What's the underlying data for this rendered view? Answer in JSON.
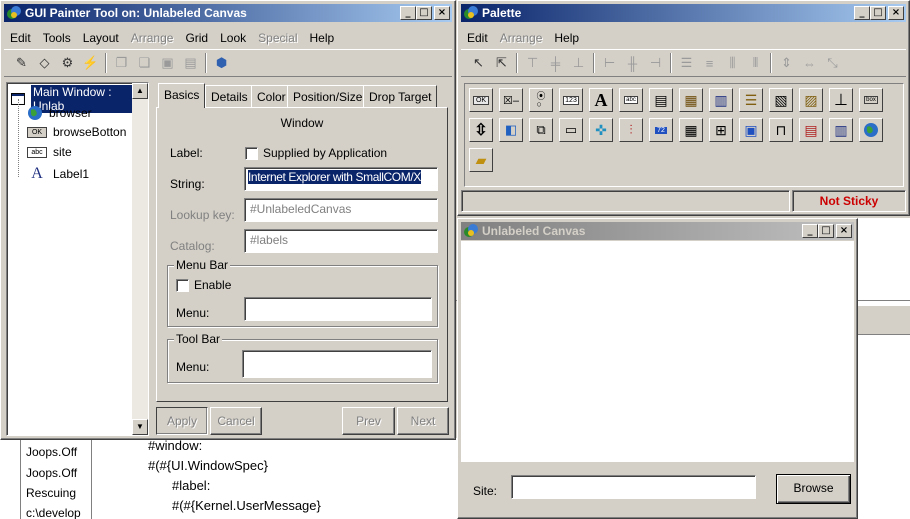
{
  "gp": {
    "title": "GUI Painter Tool on: Unlabeled Canvas",
    "menu": [
      {
        "label": "Edit",
        "enabled": true
      },
      {
        "label": "Tools",
        "enabled": true
      },
      {
        "label": "Layout",
        "enabled": true
      },
      {
        "label": "Arrange",
        "enabled": false
      },
      {
        "label": "Grid",
        "enabled": true
      },
      {
        "label": "Look",
        "enabled": true
      },
      {
        "label": "Special",
        "enabled": false
      },
      {
        "label": "Help",
        "enabled": true
      }
    ],
    "tree": [
      {
        "label": "Main Window : Unlab",
        "icon": "window-icon",
        "selected": true
      },
      {
        "label": "browser",
        "icon": "globe-icon"
      },
      {
        "label": "browseBotton",
        "icon": "ok-button-icon"
      },
      {
        "label": "site",
        "icon": "input-field-icon"
      },
      {
        "label": "Label1",
        "icon": "label-a-icon"
      }
    ],
    "tabs": [
      "Basics",
      "Details",
      "Color",
      "Position/Size",
      "Drop Target"
    ],
    "panel_title": "Window",
    "label_label": "Label:",
    "supplied_label": "Supplied by Application",
    "string_label": "String:",
    "string_value": "Internet Explorer with SmallCOM/X",
    "lookup_label": "Lookup key:",
    "lookup_value": "#UnlabeledCanvas",
    "catalog_label": "Catalog:",
    "catalog_value": "#labels",
    "menubar_group": "Menu Bar",
    "enable_label": "Enable",
    "menu_label": "Menu:",
    "toolbar_group": "Tool Bar",
    "toolbar_menu_label": "Menu:",
    "apply": "Apply",
    "cancel": "Cancel",
    "prev": "Prev",
    "next": "Next"
  },
  "palette": {
    "title": "Palette",
    "menu": [
      {
        "label": "Edit",
        "enabled": true
      },
      {
        "label": "Arrange",
        "enabled": false
      },
      {
        "label": "Help",
        "enabled": true
      }
    ],
    "status": "Not Sticky",
    "status_color": "#cc0000"
  },
  "canvas": {
    "title": "Unlabeled Canvas",
    "site_label": "Site:",
    "browse": "Browse"
  },
  "background": {
    "list": [
      "Joops.Off",
      "Joops.Off",
      "Rescuing",
      "c:\\develop"
    ],
    "code": [
      "#window:",
      "#(#{UI.WindowSpec}",
      "#label:",
      "#(#{Kernel.UserMessage}"
    ]
  }
}
